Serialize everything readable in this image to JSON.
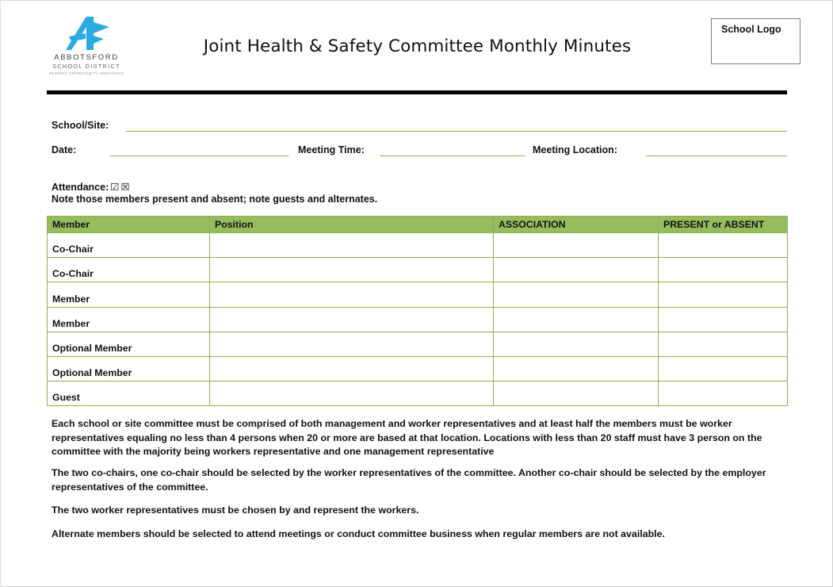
{
  "header": {
    "title": "Joint Health & Safety Committee Monthly Minutes",
    "logo": {
      "icon": "abbotsford-a-mark",
      "name": "ABBOTSFORD",
      "subtitle": "SCHOOL DISTRICT",
      "tagline": "RESPECT  OPPORTUNITY  INNOVATION",
      "color": "#29abe2"
    },
    "school_logo_placeholder": "School Logo"
  },
  "form": {
    "school_site_label": "School/Site:",
    "school_site_value": "",
    "date_label": "Date:",
    "date_value": "",
    "meeting_time_label": "Meeting Time:",
    "meeting_time_value": "",
    "meeting_location_label": "Meeting Location:",
    "meeting_location_value": ""
  },
  "attendance": {
    "label": "Attendance:",
    "present_glyph": "☑",
    "absent_glyph": "☒",
    "note": "Note those members present and absent; note guests and alternates."
  },
  "table": {
    "accent_color": "#95bd5e",
    "border_color": "#8fae4e",
    "columns": [
      "Member",
      "Position",
      "ASSOCIATION",
      "PRESENT or ABSENT"
    ],
    "rows": [
      {
        "member": "Co-Chair",
        "position": "",
        "association": "",
        "present_or_absent": ""
      },
      {
        "member": "Co-Chair",
        "position": "",
        "association": "",
        "present_or_absent": ""
      },
      {
        "member": "Member",
        "position": "",
        "association": "",
        "present_or_absent": ""
      },
      {
        "member": "Member",
        "position": "",
        "association": "",
        "present_or_absent": ""
      },
      {
        "member": "Optional  Member",
        "position": "",
        "association": "",
        "present_or_absent": ""
      },
      {
        "member": "Optional  Member",
        "position": "",
        "association": "",
        "present_or_absent": ""
      },
      {
        "member": "Guest",
        "position": "",
        "association": "",
        "present_or_absent": ""
      }
    ]
  },
  "paragraphs": {
    "p1": "Each school or site committee must be comprised of both management and worker representatives and at least half the members must be worker representatives equaling no less than 4 persons when 20 or more are based at that location. Locations with less than 20 staff must have 3 person on the committee with the majority being workers representative and one management representative",
    "p2": "The two co-chairs, one co-chair should be selected by the worker representatives of the committee. Another co-chair should be selected by the employer representatives of the committee.",
    "p3": "The two worker representatives must be chosen by and represent the workers.",
    "p4": "Alternate members should be selected to attend meetings or conduct committee business when regular members are not available."
  }
}
